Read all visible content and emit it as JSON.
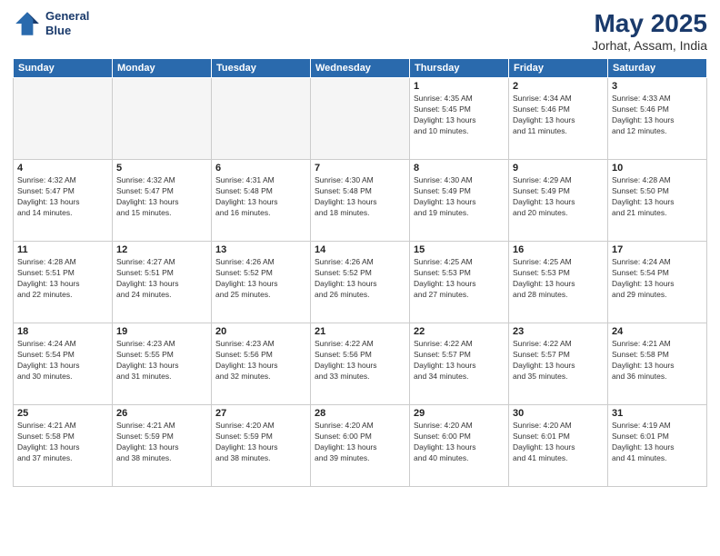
{
  "header": {
    "logo_line1": "General",
    "logo_line2": "Blue",
    "month": "May 2025",
    "location": "Jorhat, Assam, India"
  },
  "weekdays": [
    "Sunday",
    "Monday",
    "Tuesday",
    "Wednesday",
    "Thursday",
    "Friday",
    "Saturday"
  ],
  "weeks": [
    [
      {
        "day": "",
        "info": ""
      },
      {
        "day": "",
        "info": ""
      },
      {
        "day": "",
        "info": ""
      },
      {
        "day": "",
        "info": ""
      },
      {
        "day": "1",
        "info": "Sunrise: 4:35 AM\nSunset: 5:45 PM\nDaylight: 13 hours\nand 10 minutes."
      },
      {
        "day": "2",
        "info": "Sunrise: 4:34 AM\nSunset: 5:46 PM\nDaylight: 13 hours\nand 11 minutes."
      },
      {
        "day": "3",
        "info": "Sunrise: 4:33 AM\nSunset: 5:46 PM\nDaylight: 13 hours\nand 12 minutes."
      }
    ],
    [
      {
        "day": "4",
        "info": "Sunrise: 4:32 AM\nSunset: 5:47 PM\nDaylight: 13 hours\nand 14 minutes."
      },
      {
        "day": "5",
        "info": "Sunrise: 4:32 AM\nSunset: 5:47 PM\nDaylight: 13 hours\nand 15 minutes."
      },
      {
        "day": "6",
        "info": "Sunrise: 4:31 AM\nSunset: 5:48 PM\nDaylight: 13 hours\nand 16 minutes."
      },
      {
        "day": "7",
        "info": "Sunrise: 4:30 AM\nSunset: 5:48 PM\nDaylight: 13 hours\nand 18 minutes."
      },
      {
        "day": "8",
        "info": "Sunrise: 4:30 AM\nSunset: 5:49 PM\nDaylight: 13 hours\nand 19 minutes."
      },
      {
        "day": "9",
        "info": "Sunrise: 4:29 AM\nSunset: 5:49 PM\nDaylight: 13 hours\nand 20 minutes."
      },
      {
        "day": "10",
        "info": "Sunrise: 4:28 AM\nSunset: 5:50 PM\nDaylight: 13 hours\nand 21 minutes."
      }
    ],
    [
      {
        "day": "11",
        "info": "Sunrise: 4:28 AM\nSunset: 5:51 PM\nDaylight: 13 hours\nand 22 minutes."
      },
      {
        "day": "12",
        "info": "Sunrise: 4:27 AM\nSunset: 5:51 PM\nDaylight: 13 hours\nand 24 minutes."
      },
      {
        "day": "13",
        "info": "Sunrise: 4:26 AM\nSunset: 5:52 PM\nDaylight: 13 hours\nand 25 minutes."
      },
      {
        "day": "14",
        "info": "Sunrise: 4:26 AM\nSunset: 5:52 PM\nDaylight: 13 hours\nand 26 minutes."
      },
      {
        "day": "15",
        "info": "Sunrise: 4:25 AM\nSunset: 5:53 PM\nDaylight: 13 hours\nand 27 minutes."
      },
      {
        "day": "16",
        "info": "Sunrise: 4:25 AM\nSunset: 5:53 PM\nDaylight: 13 hours\nand 28 minutes."
      },
      {
        "day": "17",
        "info": "Sunrise: 4:24 AM\nSunset: 5:54 PM\nDaylight: 13 hours\nand 29 minutes."
      }
    ],
    [
      {
        "day": "18",
        "info": "Sunrise: 4:24 AM\nSunset: 5:54 PM\nDaylight: 13 hours\nand 30 minutes."
      },
      {
        "day": "19",
        "info": "Sunrise: 4:23 AM\nSunset: 5:55 PM\nDaylight: 13 hours\nand 31 minutes."
      },
      {
        "day": "20",
        "info": "Sunrise: 4:23 AM\nSunset: 5:56 PM\nDaylight: 13 hours\nand 32 minutes."
      },
      {
        "day": "21",
        "info": "Sunrise: 4:22 AM\nSunset: 5:56 PM\nDaylight: 13 hours\nand 33 minutes."
      },
      {
        "day": "22",
        "info": "Sunrise: 4:22 AM\nSunset: 5:57 PM\nDaylight: 13 hours\nand 34 minutes."
      },
      {
        "day": "23",
        "info": "Sunrise: 4:22 AM\nSunset: 5:57 PM\nDaylight: 13 hours\nand 35 minutes."
      },
      {
        "day": "24",
        "info": "Sunrise: 4:21 AM\nSunset: 5:58 PM\nDaylight: 13 hours\nand 36 minutes."
      }
    ],
    [
      {
        "day": "25",
        "info": "Sunrise: 4:21 AM\nSunset: 5:58 PM\nDaylight: 13 hours\nand 37 minutes."
      },
      {
        "day": "26",
        "info": "Sunrise: 4:21 AM\nSunset: 5:59 PM\nDaylight: 13 hours\nand 38 minutes."
      },
      {
        "day": "27",
        "info": "Sunrise: 4:20 AM\nSunset: 5:59 PM\nDaylight: 13 hours\nand 38 minutes."
      },
      {
        "day": "28",
        "info": "Sunrise: 4:20 AM\nSunset: 6:00 PM\nDaylight: 13 hours\nand 39 minutes."
      },
      {
        "day": "29",
        "info": "Sunrise: 4:20 AM\nSunset: 6:00 PM\nDaylight: 13 hours\nand 40 minutes."
      },
      {
        "day": "30",
        "info": "Sunrise: 4:20 AM\nSunset: 6:01 PM\nDaylight: 13 hours\nand 41 minutes."
      },
      {
        "day": "31",
        "info": "Sunrise: 4:19 AM\nSunset: 6:01 PM\nDaylight: 13 hours\nand 41 minutes."
      }
    ]
  ]
}
